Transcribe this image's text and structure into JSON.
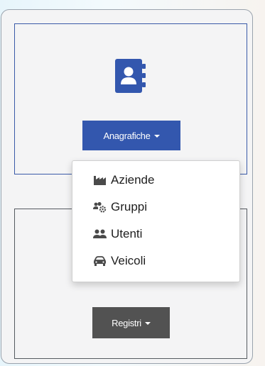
{
  "cards": [
    {
      "button_label": "Anagrafiche",
      "icon": "address-book-icon",
      "color": "#3357ae"
    },
    {
      "button_label": "Registri",
      "color": "#525252"
    }
  ],
  "dropdown": {
    "items": [
      {
        "label": "Aziende",
        "icon": "industry-icon"
      },
      {
        "label": "Gruppi",
        "icon": "users-cog-icon"
      },
      {
        "label": "Utenti",
        "icon": "users-icon"
      },
      {
        "label": "Veicoli",
        "icon": "car-icon"
      }
    ]
  }
}
